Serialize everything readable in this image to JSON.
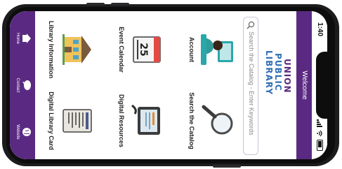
{
  "status": {
    "time": "1:40"
  },
  "header": {
    "title": "Welcome"
  },
  "logo": {
    "line1": "UNION",
    "line2": "PUBLIC",
    "line3": "LIBRARY"
  },
  "search": {
    "placeholder": "Search the Catalog - Enter Keywords"
  },
  "tiles": [
    {
      "label": "Account",
      "icon": "account-icon"
    },
    {
      "label": "Search the Catalog",
      "icon": "magnifier-icon"
    },
    {
      "label": "Event Calendar",
      "icon": "calendar-icon",
      "calendar_day": "25"
    },
    {
      "label": "Digital Resources",
      "icon": "tablet-icon"
    },
    {
      "label": "Library Information",
      "icon": "library-building-icon"
    },
    {
      "label": "Digital Library Card",
      "icon": "library-card-icon"
    }
  ],
  "nav": [
    {
      "label": "Home",
      "icon": "home-icon"
    },
    {
      "label": "Contact",
      "icon": "chat-icon"
    },
    {
      "label": "Website",
      "icon": "globe-icon"
    }
  ],
  "colors": {
    "brand_purple": "#5a2a82",
    "logo_blue": "#2e6fb4",
    "logo_purple": "#5a2a82"
  }
}
